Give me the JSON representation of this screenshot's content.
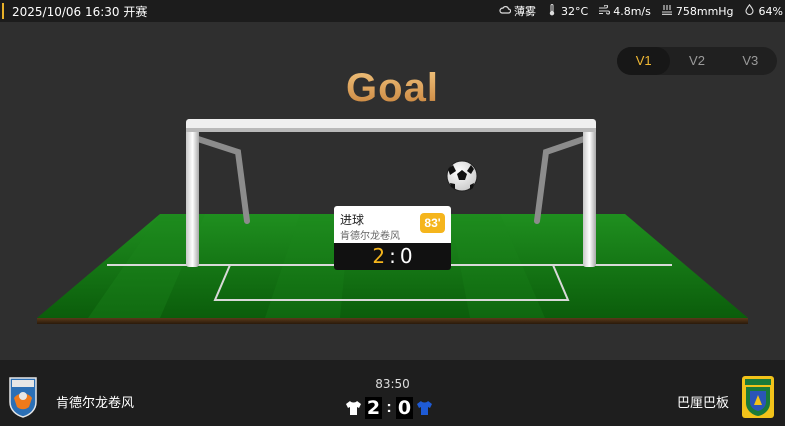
{
  "header": {
    "datetime": "2025/10/06 16:30 开赛",
    "weather": [
      {
        "icon": "cloud-icon",
        "text": "薄雾"
      },
      {
        "icon": "thermometer-icon",
        "text": "32°C"
      },
      {
        "icon": "wind-icon",
        "text": "4.8m/s"
      },
      {
        "icon": "pressure-icon",
        "text": "758mmHg"
      },
      {
        "icon": "humidity-icon",
        "text": "64%"
      }
    ]
  },
  "view_tabs": [
    {
      "label": "V1",
      "active": true
    },
    {
      "label": "V2",
      "active": false
    },
    {
      "label": "V3",
      "active": false
    }
  ],
  "animation": {
    "title": "Goal"
  },
  "event_popup": {
    "event": "进球",
    "team": "肯德尔龙卷风",
    "minute": "83'",
    "score_home": "2",
    "score_sep": ":",
    "score_away": "0"
  },
  "match": {
    "home_team": "肯德尔龙卷风",
    "away_team": "巴厘巴板",
    "clock": "83:50",
    "score_home": "2",
    "score_away": "0",
    "score_sep": ":",
    "home_kit_color": "#ffffff",
    "away_kit_color": "#1e5bd6"
  },
  "colors": {
    "accent": "#f0b833",
    "pitch": "#1a8a1a"
  }
}
